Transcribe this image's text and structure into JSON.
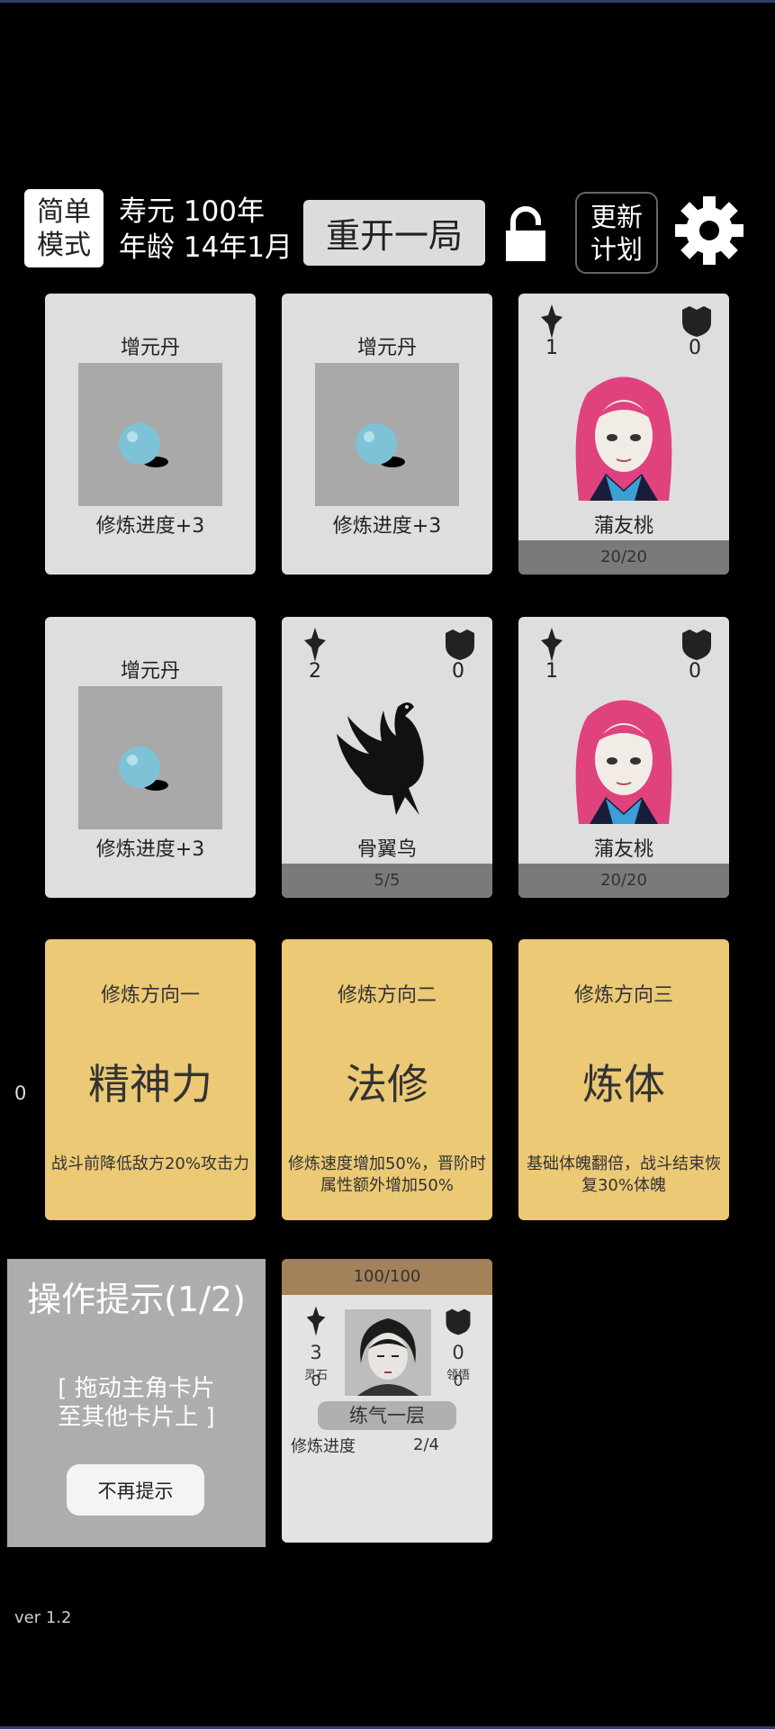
{
  "header": {
    "mode_line1": "简单",
    "mode_line2": "模式",
    "lifespan": "寿元 100年",
    "age": "年龄 14年1月",
    "restart_label": "重开一局",
    "plan_line1": "更新",
    "plan_line2": "计划"
  },
  "cards": [
    {
      "kind": "pill",
      "title": "增元丹",
      "desc": "修炼进度+3"
    },
    {
      "kind": "pill",
      "title": "增元丹",
      "desc": "修炼进度+3"
    },
    {
      "kind": "enemy",
      "attack": "1",
      "defense": "0",
      "name": "蒲友桃",
      "hp": "20/20",
      "portrait": "pink-hair-girl"
    },
    {
      "kind": "pill",
      "title": "增元丹",
      "desc": "修炼进度+3"
    },
    {
      "kind": "enemy",
      "attack": "2",
      "defense": "0",
      "name": "骨翼鸟",
      "hp": "5/5",
      "portrait": "black-bird"
    },
    {
      "kind": "enemy",
      "attack": "1",
      "defense": "0",
      "name": "蒲友桃",
      "hp": "20/20",
      "portrait": "pink-hair-girl"
    }
  ],
  "directions": [
    {
      "title": "修炼方向一",
      "name": "精神力",
      "desc": "战斗前降低敌方20%攻击力"
    },
    {
      "title": "修炼方向二",
      "name": "法修",
      "desc": "修炼速度增加50%，晋阶时属性额外增加50%"
    },
    {
      "title": "修炼方向三",
      "name": "炼体",
      "desc": "基础体魄翻倍，战斗结束恢复30%体魄"
    }
  ],
  "side_counter": "0",
  "hint": {
    "title": "操作提示(1/2)",
    "line1": "[ 拖动主角卡片",
    "line2": "至其他卡片上 ]",
    "dismiss_label": "不再提示"
  },
  "hero": {
    "hp": "100/100",
    "attack": "3",
    "attack_label": "灵石",
    "attack_sub": "0",
    "defense": "0",
    "defense_label": "领悟",
    "defense_sub": "0",
    "realm": "练气一层",
    "progress_label": "修炼进度",
    "progress_value": "2/4"
  },
  "version": "ver 1.2",
  "colors": {
    "direction_card": "#ebc975",
    "hero_hp_bar": "#a3825a",
    "enemy_hp_bar": "#7a7a7a"
  }
}
